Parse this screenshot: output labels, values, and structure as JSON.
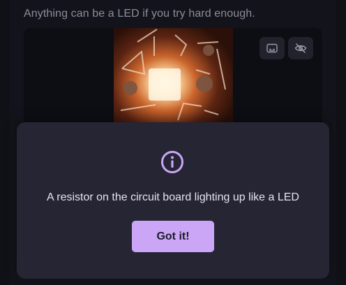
{
  "caption": "Anything can be a LED if you try hard enough.",
  "media": {
    "captions_button_icon": "captions-icon",
    "hide_button_icon": "eye-off-icon"
  },
  "dialog": {
    "icon": "info-icon",
    "alt_text": "A resistor on the circuit board lighting up like a LED",
    "confirm_label": "Got it!"
  },
  "colors": {
    "accent": "#cba6f7",
    "dialog_background": "#252534",
    "page_background": "#101017"
  }
}
